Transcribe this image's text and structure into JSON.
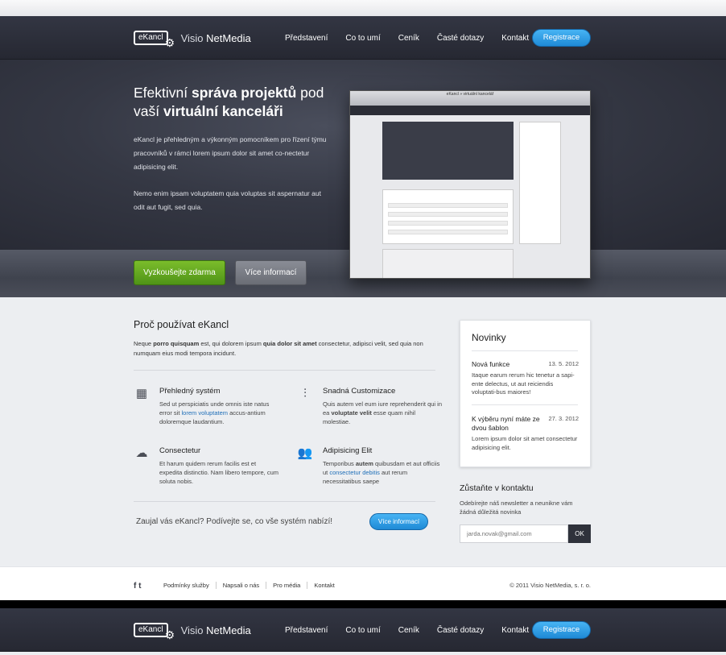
{
  "brand": {
    "badge": "eKancl",
    "name_a": "Visio ",
    "name_b": "NetMedia"
  },
  "nav": {
    "items": [
      "Představení",
      "Co to umí",
      "Ceník",
      "Časté dotazy",
      "Kontakt"
    ],
    "register": "Registrace"
  },
  "hero": {
    "title_1": "Efektivní ",
    "title_2": "správa projektů",
    "title_3": " pod vaší ",
    "title_4": "virtuální kanceláři",
    "p1": "eKancl je přehledným a výkonným pomocníkem pro řízení týmu pracovníků v rámci lorem ipsum dolor sit amet co-nectetur adipisicing elit.",
    "p2": "Nemo enim ipsam voluptatem quia voluptas sit aspernatur aut odit aut fugit, sed quia.",
    "try": "Vyzkoušejte zdarma",
    "more": "Více informací"
  },
  "mockup": {
    "url": "eKancl » virtuální kancelář"
  },
  "why": {
    "title": "Proč používat eKancl",
    "lead_1": "Neque ",
    "lead_2": "porro quisquam",
    "lead_3": " est, qui dolorem ipsum ",
    "lead_4": "quia dolor sit amet",
    "lead_5": " consectetur, adipisci velit, sed quia non numquam eius modi tempora incidunt.",
    "features": [
      {
        "title": "Přehledný systém",
        "a": "Sed ut perspiciatis unde omnis iste natus error sit ",
        "link": "lorem voluptatem",
        "b": " accus-antium doloremque laudantium."
      },
      {
        "title": "Snadná Customizace",
        "a": "Quis autem vel eum iure reprehenderit qui in ea ",
        "bold": "voluptate velit",
        "b": " esse quam nihil molestiae."
      },
      {
        "title": "Consectetur",
        "a": "Et harum quidem rerum facilis est et expedita distinctio. Nam libero tempore, cum soluta nobis."
      },
      {
        "title": "Adipisicing Elit",
        "a": "Temporibus ",
        "bold": "autem",
        "b": " quibusdam et aut officiis ut ",
        "link": "consectetur debitis",
        "c": " aut rerum necessitatibus saepe"
      }
    ],
    "cta": "Zaujal vás eKancl? Podívejte se, co vše systém nabízí!",
    "cta_button": "Více informací"
  },
  "news": {
    "title": "Novinky",
    "items": [
      {
        "title": "Nová funkce",
        "date": "13. 5. 2012",
        "text": "Itaque earum rerum hic tenetur a sapi-ente delectus, ut aut reiciendis voluptati-bus maiores!"
      },
      {
        "title": "K výběru nyní máte ze dvou šablon",
        "date": "27. 3. 2012",
        "text": "Lorem ipsum dolor sit amet consectetur adipisicing elit."
      }
    ]
  },
  "contact": {
    "title": "Zůstaňte v kontaktu",
    "text": "Odebírejte náš newsletter a neunikne vám žádná důležitá novinka",
    "placeholder": "jarda.novak@gmail.com",
    "ok": "OK"
  },
  "footer": {
    "social": "f  t",
    "links": [
      "Podmínky služby",
      "Napsali o nás",
      "Pro média",
      "Kontakt"
    ],
    "copyright": "© 2011 Visio NetMedia, s. r. o."
  },
  "colors": {
    "accent_blue": "#2a9ae6",
    "green": "#66a822",
    "dark": "#2b2d36"
  }
}
